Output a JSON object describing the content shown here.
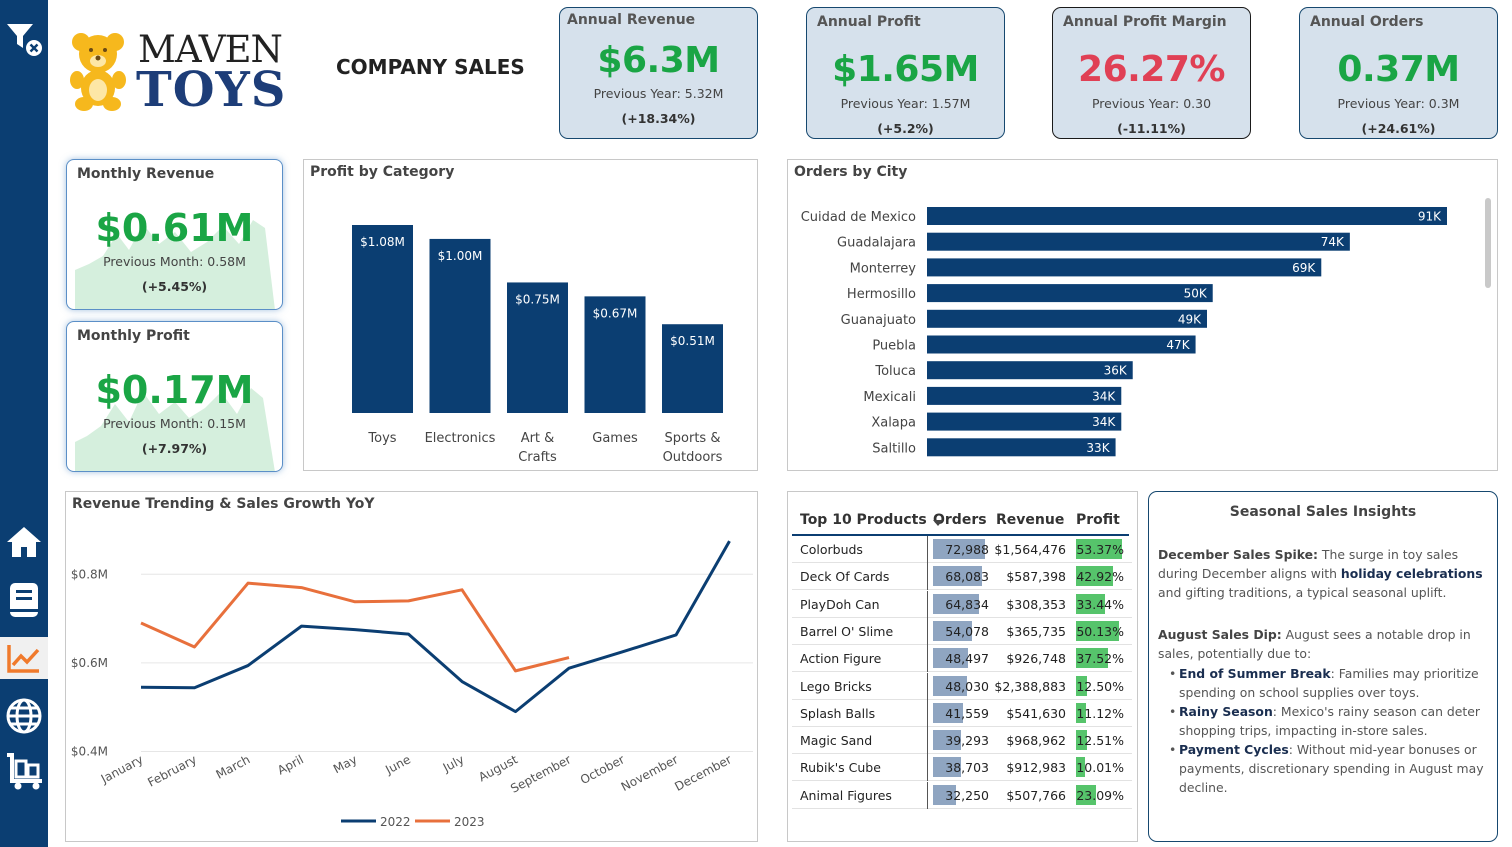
{
  "sidebar": {
    "items": [
      "filter-clear",
      "home",
      "report",
      "analytics",
      "globe",
      "warehouse"
    ]
  },
  "brand": {
    "logo_line1": "MAVEN",
    "logo_line2": "TOYS"
  },
  "page_title": "COMPANY SALES",
  "kpis": [
    {
      "title": "Annual Revenue",
      "value": "$6.3M",
      "prev": "Previous Year: 5.32M",
      "change": "(+18.34%)",
      "color": "#1aa545"
    },
    {
      "title": "Annual Profit",
      "value": "$1.65M",
      "prev": "Previous Year: 1.57M",
      "change": "(+5.2%)",
      "color": "#1aa545"
    },
    {
      "title": "Annual Profit Margin",
      "value": "26.27%",
      "prev": "Previous Year: 0.30",
      "change": "(-11.11%)",
      "color": "#e04055"
    },
    {
      "title": "Annual Orders",
      "value": "0.37M",
      "prev": "Previous Year: 0.3M",
      "change": "(+24.61%)",
      "color": "#1aa545"
    }
  ],
  "monthly": [
    {
      "title": "Monthly Revenue",
      "value": "$0.61M",
      "prev": "Previous Month: 0.58M",
      "change": "(+5.45%)"
    },
    {
      "title": "Monthly Profit",
      "value": "$0.17M",
      "prev": "Previous Month: 0.15M",
      "change": "(+7.97%)"
    }
  ],
  "chart_data": [
    {
      "type": "bar",
      "title": "Profit by Category",
      "categories": [
        "Toys",
        "Electronics",
        "Art & Crafts",
        "Games",
        "Sports & Outdoors"
      ],
      "values": [
        1.08,
        1.0,
        0.75,
        0.67,
        0.51
      ],
      "labels": [
        "$1.08M",
        "$1.00M",
        "$0.75M",
        "$0.67M",
        "$0.51M"
      ],
      "color": "#0b3e72"
    },
    {
      "type": "bar",
      "orientation": "horizontal",
      "title": "Orders by City",
      "categories": [
        "Cuidad de Mexico",
        "Guadalajara",
        "Monterrey",
        "Hermosillo",
        "Guanajuato",
        "Puebla",
        "Toluca",
        "Mexicali",
        "Xalapa",
        "Saltillo"
      ],
      "values": [
        91,
        74,
        69,
        50,
        49,
        47,
        36,
        34,
        34,
        33
      ],
      "labels": [
        "91K",
        "74K",
        "69K",
        "50K",
        "49K",
        "47K",
        "36K",
        "34K",
        "34K",
        "33K"
      ],
      "color": "#0b3e72"
    },
    {
      "type": "line",
      "title": "Revenue Trending & Sales Growth YoY",
      "x": [
        "January",
        "February",
        "March",
        "April",
        "May",
        "June",
        "July",
        "August",
        "September",
        "October",
        "November",
        "December"
      ],
      "ylim": [
        0.4,
        0.9
      ],
      "yticks": [
        "$0.4M",
        "$0.6M",
        "$0.8M"
      ],
      "series": [
        {
          "name": "2022",
          "color": "#0b3e72",
          "values": [
            0.545,
            0.544,
            0.594,
            0.683,
            0.675,
            0.665,
            0.558,
            0.49,
            0.588,
            0.625,
            0.663,
            0.875
          ]
        },
        {
          "name": "2023",
          "color": "#e8703c",
          "values": [
            0.69,
            0.636,
            0.78,
            0.77,
            0.738,
            0.74,
            0.765,
            0.582,
            0.612,
            null,
            null,
            null
          ]
        }
      ]
    }
  ],
  "products": {
    "title": "Top 10 Products",
    "col_orders": "Orders",
    "col_revenue": "Revenue",
    "col_profit": "Profit",
    "rows": [
      {
        "name": "Colorbuds",
        "orders": "72,988",
        "revenue": "$1,564,476",
        "profit": "53.37%",
        "o": 72988,
        "p": 53.37
      },
      {
        "name": "Deck Of Cards",
        "orders": "68,083",
        "revenue": "$587,398",
        "profit": "42.92%",
        "o": 68083,
        "p": 42.92
      },
      {
        "name": "PlayDoh Can",
        "orders": "64,834",
        "revenue": "$308,353",
        "profit": "33.44%",
        "o": 64834,
        "p": 33.44
      },
      {
        "name": "Barrel O' Slime",
        "orders": "54,078",
        "revenue": "$365,735",
        "profit": "50.13%",
        "o": 54078,
        "p": 50.13
      },
      {
        "name": "Action Figure",
        "orders": "48,497",
        "revenue": "$926,748",
        "profit": "37.52%",
        "o": 48497,
        "p": 37.52
      },
      {
        "name": "Lego Bricks",
        "orders": "48,030",
        "revenue": "$2,388,883",
        "profit": "12.50%",
        "o": 48030,
        "p": 12.5
      },
      {
        "name": "Splash Balls",
        "orders": "41,559",
        "revenue": "$541,630",
        "profit": "11.12%",
        "o": 41559,
        "p": 11.12
      },
      {
        "name": "Magic Sand",
        "orders": "39,293",
        "revenue": "$968,962",
        "profit": "12.51%",
        "o": 39293,
        "p": 12.51
      },
      {
        "name": "Rubik's Cube",
        "orders": "38,703",
        "revenue": "$912,983",
        "profit": "10.01%",
        "o": 38703,
        "p": 10.01
      },
      {
        "name": "Animal Figures",
        "orders": "32,250",
        "revenue": "$507,766",
        "profit": "23.09%",
        "o": 32250,
        "p": 23.09
      }
    ]
  },
  "insights": {
    "title": "Seasonal Sales Insights",
    "p1_head": "December Sales Spike:",
    "p1_a": " The surge in toy sales during December aligns with ",
    "p1_bold": "holiday celebrations",
    "p1_b": " and gifting traditions, a typical seasonal uplift.",
    "p2_head": "August Sales Dip:",
    "p2_a": " August sees a notable drop in sales, potentially due to:",
    "bullets": [
      {
        "head": "End of Summer Break",
        "text": ": Families may prioritize spending on school supplies over toys."
      },
      {
        "head": "Rainy Season",
        "text": ": Mexico's rainy season can deter shopping trips, impacting in-store sales."
      },
      {
        "head": "Payment Cycles",
        "text": ": Without mid-year bonuses or payments, discretionary spending in August may decline."
      }
    ]
  }
}
